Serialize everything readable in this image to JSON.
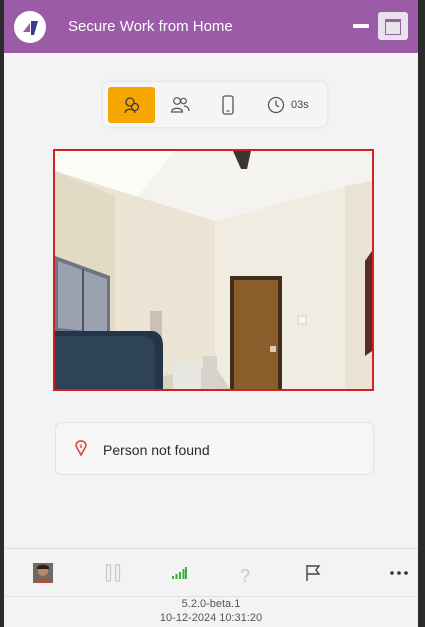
{
  "window": {
    "title": "Secure Work from Home",
    "accent_color": "#9b5ba7"
  },
  "toolbar": {
    "tools": [
      {
        "name": "face-detection",
        "icon": "faces-icon",
        "active": true
      },
      {
        "name": "multiple-persons",
        "icon": "people-icon",
        "active": false
      },
      {
        "name": "mobile-phone",
        "icon": "phone-icon",
        "active": false
      },
      {
        "name": "timer",
        "icon": "clock-icon",
        "active": false
      }
    ],
    "timer_value": "03s",
    "active_color": "#f7a600"
  },
  "camera": {
    "border_color": "#d42020"
  },
  "status": {
    "text": "Person not found",
    "icon": "warning-pin-icon"
  },
  "bottombar": {
    "items": [
      "avatar",
      "pause-icon",
      "signal-icon",
      "help-icon",
      "flag-icon",
      "more-icon"
    ],
    "help_glyph": "?",
    "more_glyph": "···"
  },
  "footer": {
    "version": "5.2.0-beta.1",
    "datetime": "10-12-2024 10:31:20"
  }
}
